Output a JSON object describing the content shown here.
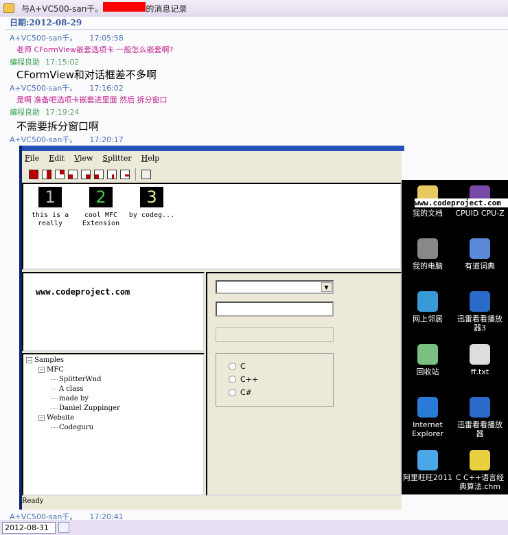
{
  "window": {
    "title_prefix": "与A+VC500-san千。",
    "title_suffix": "的消息记录"
  },
  "date_label": "日期:2012-08-29",
  "messages": [
    {
      "sender": "A+VC500-san千。",
      "time": "17:05:58",
      "text": "老师 CFormView嵌套选项卡 一般怎么嵌套啊?",
      "role": "a"
    },
    {
      "sender": "编程良助",
      "time": "17:15:02",
      "text": "CFormView和对话框差不多啊",
      "role": "b"
    },
    {
      "sender": "A+VC500-san千。",
      "time": "17:16:02",
      "text": "是啊  准备吧选项卡嵌套进里面 然后 拆分窗口",
      "role": "a"
    },
    {
      "sender": "编程良助",
      "time": "17:19:24",
      "text": "不需要拆分窗口啊",
      "role": "b"
    },
    {
      "sender": "A+VC500-san千。",
      "time": "17:20:17",
      "text": "",
      "role": "a"
    }
  ],
  "last_message": {
    "sender": "A+VC500-san千。",
    "time": "17:20:41"
  },
  "app": {
    "menu": [
      {
        "key": "F",
        "rest": "ile"
      },
      {
        "key": "E",
        "rest": "dit"
      },
      {
        "key": "V",
        "rest": "iew"
      },
      {
        "key": "S",
        "rest": "plitter"
      },
      {
        "key": "H",
        "rest": "elp"
      }
    ],
    "thumbs": [
      {
        "digit": "1",
        "label1": "this is a",
        "label2": "really",
        "color": "#bbbbbb"
      },
      {
        "digit": "2",
        "label1": "cool MFC",
        "label2": "Extension",
        "color": "#44cc44"
      },
      {
        "digit": "3",
        "label1": "by codeg...",
        "label2": "",
        "color": "#eeee99"
      }
    ],
    "url": "www.codeproject.com",
    "tree": [
      {
        "text": "Samples",
        "level": 0,
        "exp": true
      },
      {
        "text": "MFC",
        "level": 1,
        "exp": true
      },
      {
        "text": "SplitterWnd",
        "level": 2
      },
      {
        "text": "A class",
        "level": 2
      },
      {
        "text": "made by",
        "level": 2
      },
      {
        "text": "Daniel Zuppinger",
        "level": 2
      },
      {
        "text": "Website",
        "level": 1,
        "exp": true
      },
      {
        "text": "Codeguru",
        "level": 2
      }
    ],
    "radios": [
      "C",
      "C++",
      "C#"
    ],
    "status": "Ready"
  },
  "desktop": {
    "overlay": "www.codeproject.com",
    "icons": [
      {
        "label": "我的文档",
        "color": "#e8c860"
      },
      {
        "label": "CPUID CPU-Z",
        "color": "#7a4aa8"
      },
      {
        "label": "我的电脑",
        "color": "#888"
      },
      {
        "label": "有道词典",
        "color": "#5a8ad8"
      },
      {
        "label": "网上邻居",
        "color": "#3a9ad8"
      },
      {
        "label": "迅雷看看播放器3",
        "color": "#2a6ac8"
      },
      {
        "label": "回收站",
        "color": "#7ac080"
      },
      {
        "label": "ff.txt",
        "color": "#ddd"
      },
      {
        "label": "Internet Explorer",
        "color": "#2a7ad8"
      },
      {
        "label": "迅雷看看播放器",
        "color": "#2a6ac8"
      },
      {
        "label": "阿里旺旺2011",
        "color": "#4aa8e8"
      },
      {
        "label": "C C++语言经典算法.chm",
        "color": "#e8d040"
      }
    ]
  },
  "footer": {
    "date_value": "2012-08-31"
  }
}
